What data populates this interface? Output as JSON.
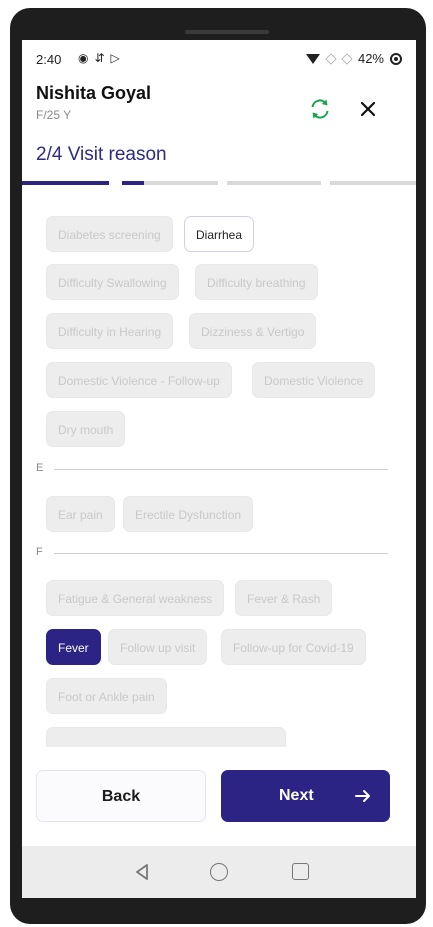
{
  "status_bar": {
    "time": "2:40",
    "battery": "42%"
  },
  "patient": {
    "name": "Nishita Goyal",
    "meta": "F/25 Y"
  },
  "step": {
    "title": "2/4 Visit reason",
    "current": 2,
    "total": 4
  },
  "reasons": {
    "group_d": [
      "Diabetes screening",
      "Diarrhea",
      "Difficulty Swallowing",
      "Difficulty breathing",
      "Difficulty in Hearing",
      "Dizziness & Vertigo",
      "Domestic Violence - Follow-up",
      "Domestic Violence",
      "Dry mouth"
    ],
    "letter_e": "E",
    "group_e": [
      "Ear pain",
      "Erectile Dysfunction"
    ],
    "letter_f": "F",
    "group_f": [
      "Fatigue & General weakness",
      "Fever & Rash",
      "Fever",
      "Follow up visit",
      "Follow-up for Covid-19",
      "Foot or Ankle pain"
    ],
    "selected": "Fever",
    "highlighted": "Diarrhea"
  },
  "footer": {
    "back_label": "Back",
    "next_label": "Next"
  },
  "colors": {
    "primary": "#2b2485",
    "refresh": "#16a34a",
    "chip_bg": "#ededed"
  },
  "icons": {
    "refresh": "refresh-icon",
    "close": "close-icon",
    "next_arrow": "arrow-right-icon"
  }
}
